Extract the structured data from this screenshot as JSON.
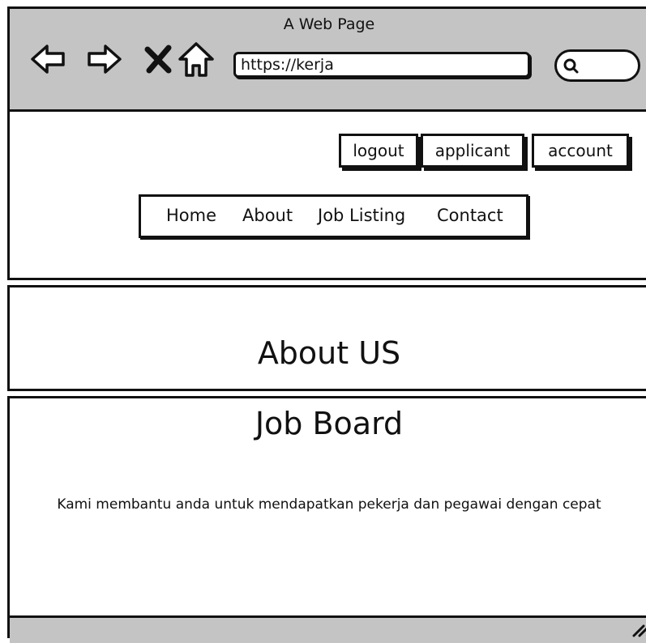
{
  "browser": {
    "title": "A Web Page",
    "url": "https://kerja",
    "icons": [
      "back-arrow-icon",
      "forward-arrow-icon",
      "close-x-icon",
      "home-icon",
      "search-icon"
    ]
  },
  "header_buttons": {
    "logout": "logout",
    "applicant": "applicant",
    "account": "account"
  },
  "nav": {
    "home": "Home",
    "about": "About",
    "job_listing": "Job Listing",
    "contact": "Contact"
  },
  "about_section": {
    "title": "About US"
  },
  "job_board": {
    "title": "Job Board",
    "tagline": "Kami membantu anda untuk mendapatkan pekerja dan pegawai dengan cepat"
  },
  "colors": {
    "chrome": "#c4c4c4",
    "ink": "#111111",
    "background": "#ffffff"
  }
}
